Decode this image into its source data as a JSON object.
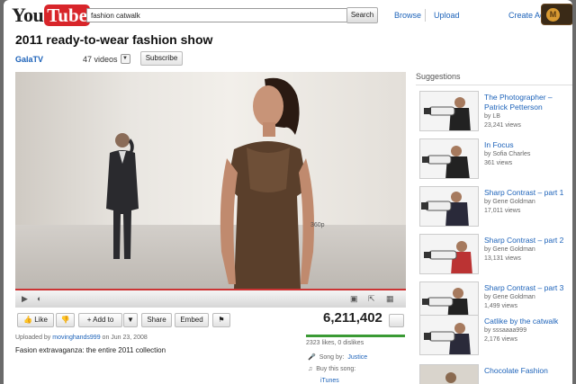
{
  "header": {
    "logo_you": "You",
    "logo_tube": "Tube",
    "search_value": "fashion catwalk",
    "search_button": "Search",
    "browse": "Browse",
    "upload": "Upload",
    "create_account": "Create Ac"
  },
  "video": {
    "title": "2011 ready-to-wear fashion show",
    "channel": "GalaTV",
    "videos_count": "47 videos",
    "subscribe": "Subscribe",
    "like": "Like",
    "add_to": "Add to",
    "share": "Share",
    "embed": "Embed",
    "views": "6,211,402",
    "uploaded_prefix": "Uploaded by",
    "uploader": "movinghands999",
    "uploaded_date": "on Jun 23, 2008",
    "description": "Fasion extravaganza: the entire 2011 collection",
    "likes_dislikes": "2323 likes, 0 dislikes",
    "song_by_label": "Song by:",
    "song_by": "Justice",
    "buy_song_label": "Buy this song:",
    "itunes": "iTunes",
    "timestamp": "360p"
  },
  "suggestions": {
    "heading": "Suggestions",
    "items": [
      {
        "title": "The Photographer – Patrick Petterson",
        "by": "by LB",
        "views": "23,241 views"
      },
      {
        "title": "In Focus",
        "by": "by Sofia Charles",
        "views": "361 views"
      },
      {
        "title": "Sharp Contrast – part 1",
        "by": "by Gene Goldman",
        "views": "17,011 views"
      },
      {
        "title": "Sharp Contrast – part 2",
        "by": "by Gene Goldman",
        "views": "13,131 views"
      },
      {
        "title": "Sharp Contrast – part 3",
        "by": "by Gene Goldman",
        "views": "1,499 views"
      },
      {
        "title": "Catlike by the catwalk",
        "by": "by sssaaaa999",
        "views": "2,176 views"
      },
      {
        "title": "Chocolate Fashion",
        "by": "",
        "views": ""
      }
    ]
  },
  "colors": {
    "link": "#1c62b9",
    "brand_red": "#d8252a",
    "progress": "#cc3333",
    "like_bar": "#3a9a34"
  }
}
